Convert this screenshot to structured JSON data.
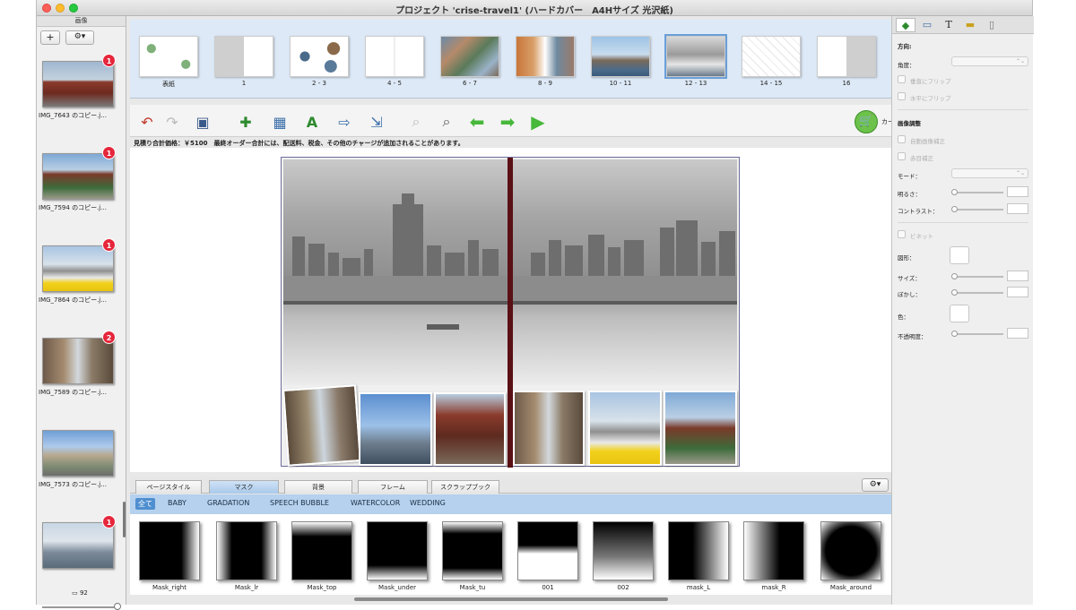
{
  "window": {
    "title": "プロジェクト 'crise-travel1' (ハードカバー　A4Hサイズ 光沢紙)"
  },
  "sidebar": {
    "header": "画像",
    "add_label": "+",
    "gear_label": "⚙▾",
    "images": [
      {
        "label": "IMG_7643 のコピー.j...",
        "badge": "1"
      },
      {
        "label": "IMG_7594 のコピー.j...",
        "badge": "1"
      },
      {
        "label": "IMG_7864 のコピー.j...",
        "badge": "1"
      },
      {
        "label": "IMG_7589 のコピー.j...",
        "badge": "2"
      },
      {
        "label": "IMG_7573 のコピー.j...",
        "badge": ""
      },
      {
        "label": "",
        "badge": "1"
      }
    ],
    "count": "92"
  },
  "pages": [
    "表紙",
    "1",
    "2 - 3",
    "4 - 5",
    "6 - 7",
    "8 - 9",
    "10 - 11",
    "12 - 13",
    "14 - 15",
    "16"
  ],
  "toolbar": {
    "cart_label": "カートに追加"
  },
  "price_text": "見積り合計価格：￥5100　最終オーダー合計には、配送料、税金、その他のチャージが追加されることがあります。",
  "bottom_tabs": [
    "ページスタイル",
    "マスク",
    "背景",
    "フレーム",
    "スクラップブック"
  ],
  "mask_categories": [
    "全て",
    "BABY",
    "GRADATION",
    "SPEECH BUBBLE",
    "WATERCOLOR",
    "WEDDING"
  ],
  "masks": [
    "Mask_right",
    "Mask_lr",
    "Mask_top",
    "Mask_under",
    "Mask_tu",
    "001",
    "002",
    "mask_L",
    "mask_R",
    "Mask_around"
  ],
  "inspector": {
    "direction_label": "方向:",
    "angle_label": "角度：",
    "flip_v": "垂直にフリップ",
    "flip_h": "水平にフリップ",
    "image_adjust": "画像調整",
    "auto_correct": "自動画像補正",
    "redeye": "赤目補正",
    "mode_label": "モード：",
    "brightness_label": "明るさ：",
    "contrast_label": "コントラスト：",
    "vignette": "ビネット",
    "shape_label": "図形：",
    "size_label": "サイズ：",
    "blur_label": "ぼかし：",
    "color_label": "色：",
    "opacity_label": "不透明度："
  }
}
